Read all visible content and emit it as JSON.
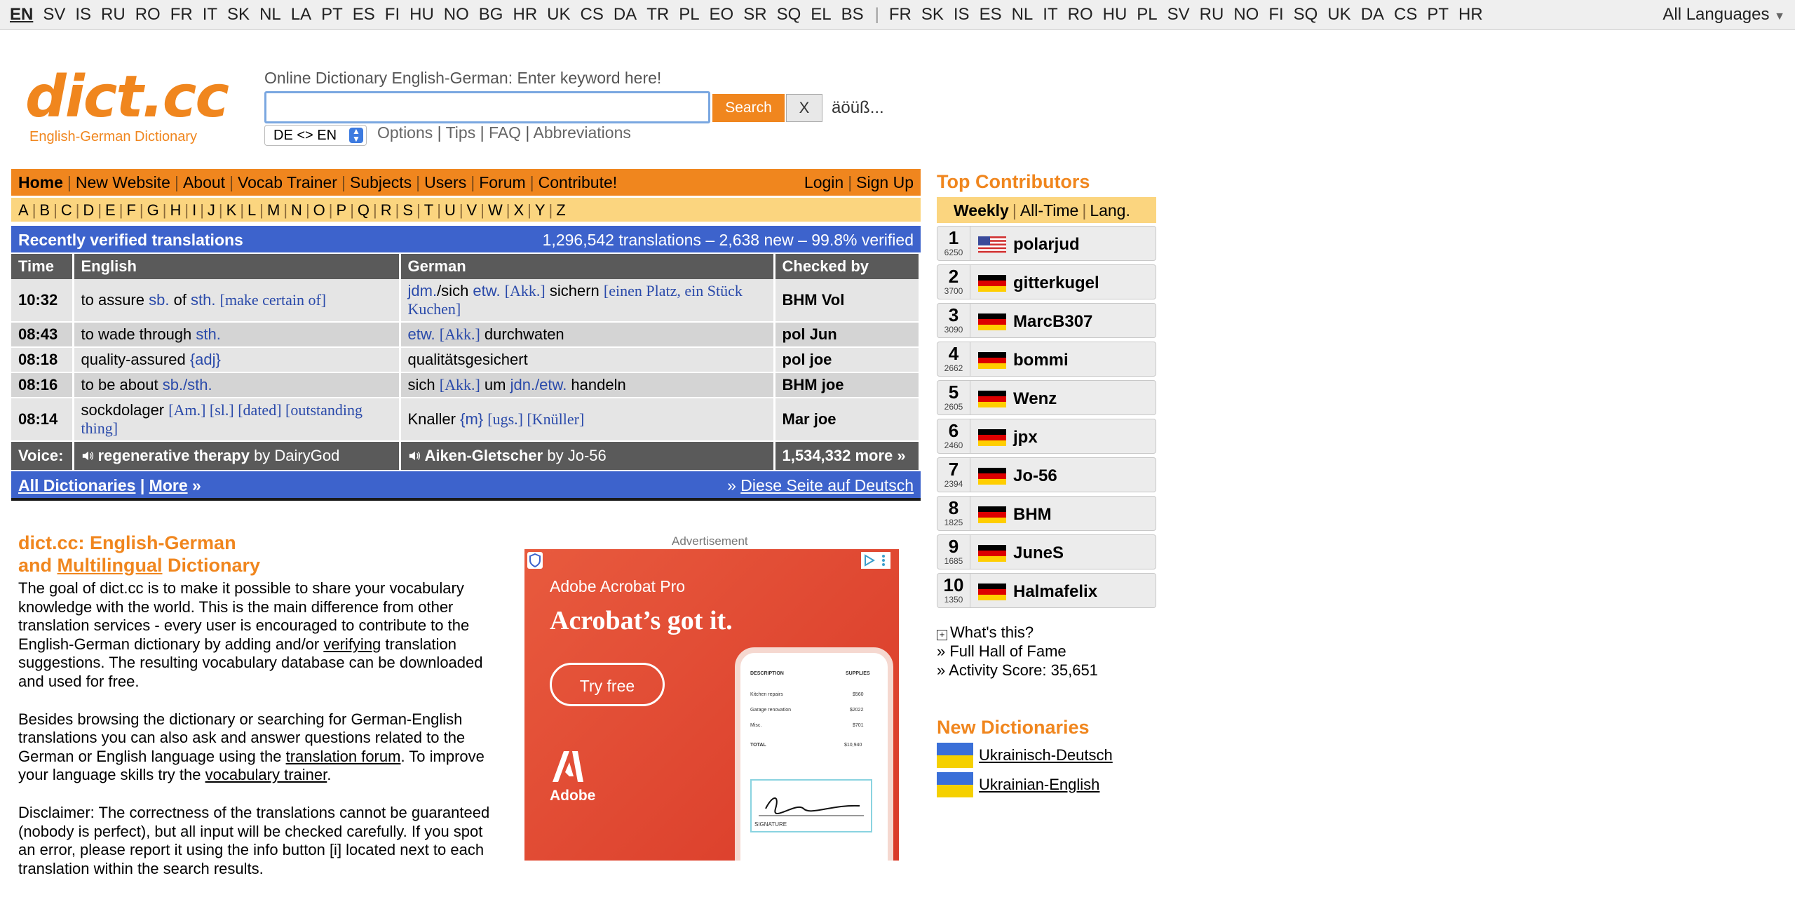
{
  "top_languages": {
    "group1": [
      "EN",
      "SV",
      "IS",
      "RU",
      "RO",
      "FR",
      "IT",
      "SK",
      "NL",
      "LA",
      "PT",
      "ES",
      "FI",
      "HU",
      "NO",
      "BG",
      "HR",
      "UK",
      "CS",
      "DA",
      "TR",
      "PL",
      "EO",
      "SR",
      "SQ",
      "EL",
      "BS"
    ],
    "group2": [
      "FR",
      "SK",
      "IS",
      "ES",
      "NL",
      "IT",
      "RO",
      "HU",
      "PL",
      "SV",
      "RU",
      "NO",
      "FI",
      "SQ",
      "UK",
      "DA",
      "CS",
      "PT",
      "HR"
    ],
    "all_languages": "All Languages"
  },
  "logo": {
    "text": "dict.cc",
    "subtitle": "English-German Dictionary"
  },
  "search": {
    "label": "Online Dictionary English-German: Enter keyword here!",
    "value": "",
    "search_button": "Search",
    "clear_button": "X",
    "special_chars": "äöüß...",
    "direction": "DE <> EN",
    "options": "Options",
    "tips": "Tips",
    "faq": "FAQ",
    "abbreviations": "Abbreviations"
  },
  "main_nav": {
    "items": [
      "Home",
      "New Website",
      "About",
      "Vocab Trainer",
      "Subjects",
      "Users",
      "Forum",
      "Contribute!"
    ],
    "login": "Login",
    "signup": "Sign Up"
  },
  "alphabet": [
    "A",
    "B",
    "C",
    "D",
    "E",
    "F",
    "G",
    "H",
    "I",
    "J",
    "K",
    "L",
    "M",
    "N",
    "O",
    "P",
    "Q",
    "R",
    "S",
    "T",
    "U",
    "V",
    "W",
    "X",
    "Y",
    "Z"
  ],
  "recent": {
    "title": "Recently verified translations",
    "stats": "1,296,542 translations – 2,638 new – 99.8% verified",
    "headers": {
      "time": "Time",
      "english": "English",
      "german": "German",
      "checked": "Checked by"
    },
    "voice": {
      "label": "Voice:",
      "english_term": "regenerative therapy",
      "english_by": "by DairyGod",
      "german_term": "Aiken-Gletscher",
      "german_by": "by Jo-56",
      "more": "1,534,332 more »"
    }
  },
  "bottom_bar": {
    "all_dicts": "All Dictionaries",
    "sep": "|",
    "more": "More",
    "more_arrow": "»",
    "german_prefix": "»",
    "german_link": "Diese Seite auf Deutsch"
  },
  "intro": {
    "title_line1": "dict.cc: English-German",
    "title_and": "and",
    "title_multilingual": "Multilingual",
    "title_dictionary": "Dictionary",
    "p1_a": "The goal of dict.cc is to make it possible to share your vocabulary knowledge with the world. This is the main difference from other translation services - every user is encouraged to contribute to the English-German dictionary by adding and/or",
    "p1_link": "verifying",
    "p1_b": "translation suggestions. The resulting vocabulary database can be downloaded and used for free.",
    "p2_a": "Besides browsing the dictionary or searching for German-English translations you can also ask and answer questions related to the German or English language using the",
    "p2_link1": "translation forum",
    "p2_b": ". To improve your language skills try the",
    "p2_link2": "vocabulary trainer",
    "p2_c": ".",
    "p3": "Disclaimer: The correctness of the translations cannot be guaranteed (nobody is perfect), but all input will be checked carefully. If you spot an error, please report it using the info button [i] located next to each translation within the search results."
  },
  "ad": {
    "label": "Advertisement",
    "brand": "Adobe Acrobat Pro",
    "headline": "Acrobat’s got it.",
    "cta": "Try free",
    "company": "Adobe",
    "phone_header_left": "DESCRIPTION",
    "phone_header_right": "SUPPLIES",
    "phone_rows": [
      {
        "l": "Kitchen repairs",
        "r": "$560"
      },
      {
        "l": "Garage renovation",
        "r": "$2022"
      },
      {
        "l": "Misc.",
        "r": "$701"
      },
      {
        "l": "TOTAL",
        "r": "$10,940"
      }
    ],
    "phone_signature": "SIGNATURE"
  },
  "contributors": {
    "title": "Top Contributors",
    "tabs": {
      "weekly": "Weekly",
      "alltime": "All-Time",
      "lang": "Lang."
    },
    "list": [
      {
        "rank": "1",
        "score": "6250",
        "name": "polarjud",
        "flag": "us"
      },
      {
        "rank": "2",
        "score": "3700",
        "name": "gitterkugel",
        "flag": "de"
      },
      {
        "rank": "3",
        "score": "3090",
        "name": "MarcB307",
        "flag": "de"
      },
      {
        "rank": "4",
        "score": "2662",
        "name": "bommi",
        "flag": "de"
      },
      {
        "rank": "5",
        "score": "2605",
        "name": "Wenz",
        "flag": "de"
      },
      {
        "rank": "6",
        "score": "2460",
        "name": "jpx",
        "flag": "de"
      },
      {
        "rank": "7",
        "score": "2394",
        "name": "Jo-56",
        "flag": "de"
      },
      {
        "rank": "8",
        "score": "1825",
        "name": "BHM",
        "flag": "de"
      },
      {
        "rank": "9",
        "score": "1685",
        "name": "JuneS",
        "flag": "de"
      },
      {
        "rank": "10",
        "score": "1350",
        "name": "Halmafelix",
        "flag": "de"
      }
    ],
    "whats_this": "What's this?",
    "hall_of_fame": "Full Hall of Fame",
    "activity": "Activity Score: 35,651"
  },
  "new_dicts": {
    "title": "New Dictionaries",
    "items": [
      "Ukrainisch-Deutsch",
      "Ukrainian-English"
    ]
  },
  "colors": {
    "accent": "#f0861e",
    "blue": "#3d63cc",
    "light_orange": "#fbd57f",
    "gray_header": "#5a5a5a"
  }
}
